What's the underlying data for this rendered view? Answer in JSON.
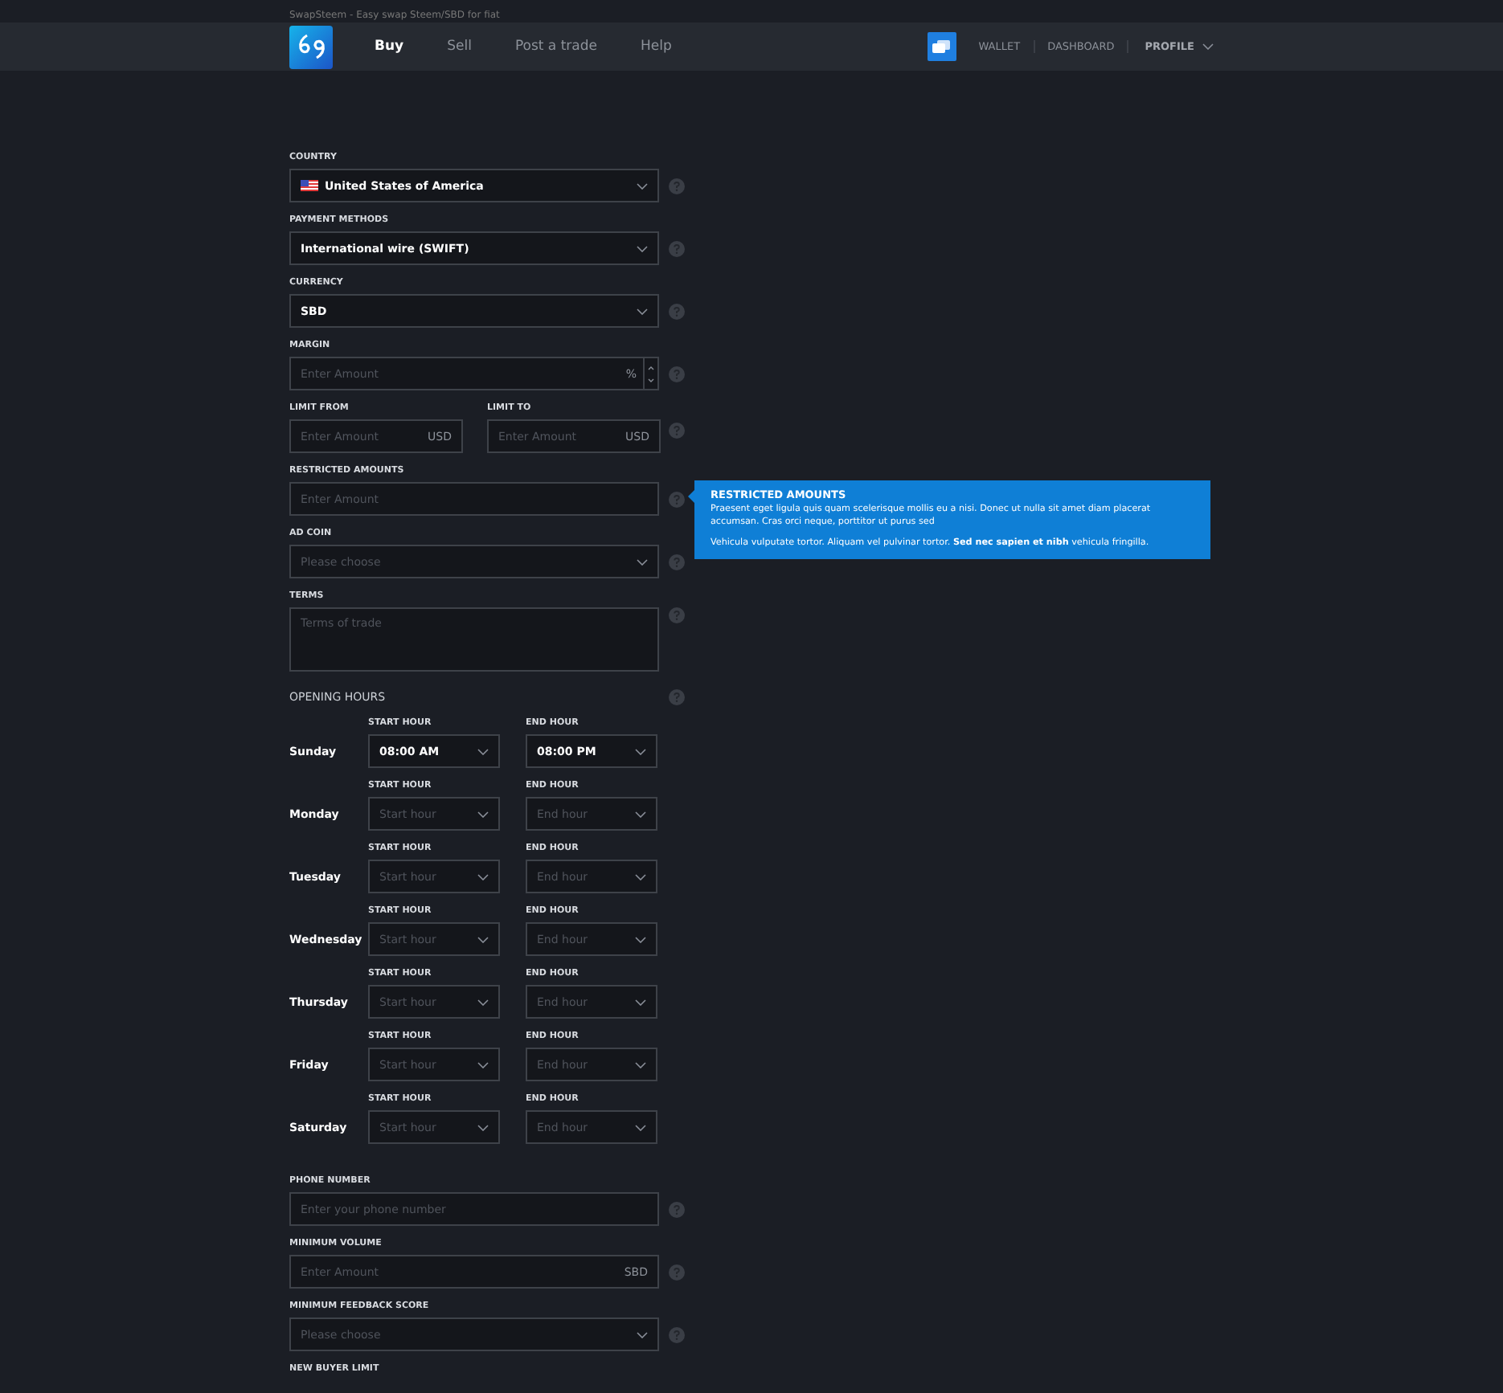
{
  "tagline": "SwapSteem - Easy swap Steem/SBD for fiat",
  "nav": {
    "tabs": [
      {
        "label": "Buy",
        "selected": true
      },
      {
        "label": "Sell",
        "selected": false
      },
      {
        "label": "Post a trade",
        "selected": false
      },
      {
        "label": "Help",
        "selected": false
      }
    ],
    "links": [
      "WALLET",
      "DASHBOARD"
    ],
    "profile": "PROFILE"
  },
  "fields": [
    {
      "kind": "select",
      "label": "COUNTRY",
      "value": "United States of America",
      "flag": true
    },
    {
      "kind": "select",
      "label": "PAYMENT METHODS",
      "value": "International wire (SWIFT)"
    },
    {
      "kind": "select",
      "label": "CURRENCY",
      "value": "SBD"
    },
    {
      "kind": "number",
      "label": "MARGIN",
      "placeholder": "Enter Amount",
      "suffix": "%"
    },
    {
      "kind": "pair",
      "items": [
        {
          "label": "LIMIT FROM",
          "placeholder": "Enter Amount",
          "suffix": "USD"
        },
        {
          "label": "LIMIT TO",
          "placeholder": "Enter Amount",
          "suffix": "USD"
        }
      ]
    },
    {
      "kind": "text",
      "label": "RESTRICTED AMOUNTS",
      "placeholder": "Enter Amount",
      "tooltip": {
        "title": "RESTRICTED AMOUNTS",
        "paragraphs": [
          "Praesent eget ligula quis quam scelerisque mollis eu a nisi. Donec ut nulla sit amet diam placerat accumsan. Cras orci neque, porttitor ut purus sed",
          "Vehicula vulputate tortor. Aliquam vel pulvinar tortor. **Sed nec sapien et nibh** vehicula fringilla."
        ]
      }
    },
    {
      "kind": "select",
      "label": "AD COIN",
      "placeholder": "Please choose"
    },
    {
      "kind": "textarea",
      "label": "TERMS",
      "placeholder": "Terms of trade"
    }
  ],
  "hours": {
    "title": "OPENING HOURS",
    "days": [
      {
        "day": "Sunday",
        "start": {
          "label": "START HOUR",
          "value": "08:00 AM"
        },
        "end": {
          "label": "END HOUR",
          "value": "08:00 PM"
        }
      },
      {
        "day": "Monday",
        "start": {
          "label": "START HOUR",
          "placeholder": "Start hour"
        },
        "end": {
          "label": "END HOUR",
          "placeholder": "End hour"
        }
      },
      {
        "day": "Tuesday",
        "start": {
          "label": "START HOUR",
          "placeholder": "Start hour"
        },
        "end": {
          "label": "END HOUR",
          "placeholder": "End hour"
        }
      },
      {
        "day": "Wednesday",
        "start": {
          "label": "START HOUR",
          "placeholder": "Start hour"
        },
        "end": {
          "label": "END HOUR",
          "placeholder": "End hour"
        }
      },
      {
        "day": "Thursday",
        "start": {
          "label": "START HOUR",
          "placeholder": "Start hour"
        },
        "end": {
          "label": "END HOUR",
          "placeholder": "End hour"
        }
      },
      {
        "day": "Friday",
        "start": {
          "label": "START HOUR",
          "placeholder": "Start hour"
        },
        "end": {
          "label": "END HOUR",
          "placeholder": "End hour"
        }
      },
      {
        "day": "Saturday",
        "start": {
          "label": "START HOUR",
          "placeholder": "Start hour"
        },
        "end": {
          "label": "END HOUR",
          "placeholder": "End hour"
        }
      }
    ]
  },
  "more_fields": [
    {
      "kind": "text",
      "label": "PHONE NUMBER",
      "placeholder": "Enter your phone number"
    },
    {
      "kind": "text",
      "label": "MINIMUM VOLUME",
      "placeholder": "Enter Amount",
      "suffix": "SBD"
    },
    {
      "kind": "select",
      "label": "MINIMUM FEEDBACK SCORE",
      "placeholder": "Please choose"
    },
    {
      "kind": "label",
      "label": "NEW BUYER LIMIT"
    }
  ]
}
